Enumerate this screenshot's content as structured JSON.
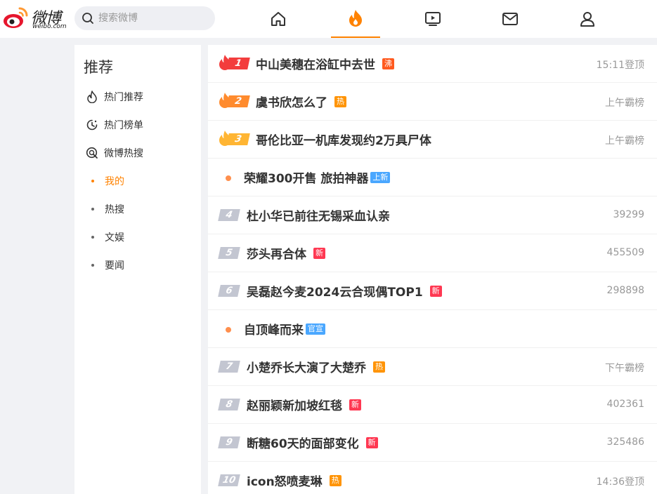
{
  "header": {
    "logo_text": "微博",
    "logo_domain": "weibo.com",
    "search_placeholder": "搜索微博",
    "nav": [
      {
        "name": "home-icon"
      },
      {
        "name": "hot-icon",
        "active": true
      },
      {
        "name": "video-icon"
      },
      {
        "name": "message-icon"
      },
      {
        "name": "profile-icon"
      }
    ]
  },
  "sidebar": {
    "title": "推荐",
    "items": [
      {
        "label": "热门推荐",
        "icon": "flame-outline-icon"
      },
      {
        "label": "热门榜单",
        "icon": "clock-icon"
      },
      {
        "label": "微博热搜",
        "icon": "search-circle-icon"
      },
      {
        "label": "我的",
        "active": true
      },
      {
        "label": "热搜"
      },
      {
        "label": "文娱"
      },
      {
        "label": "要闻"
      }
    ]
  },
  "colors": {
    "accent": "#ff8200",
    "badge_boil": "#ff5a1f",
    "badge_hot": "#ff9406",
    "badge_new": "#ff3852",
    "badge_up": "#4aa7ff",
    "badge_official": "#4aa7ff"
  },
  "hot_list": [
    {
      "rank": "1",
      "title": "中山美穗在浴缸中去世",
      "badge": "沸",
      "badge_type": "boil",
      "meta": "15:11登顶"
    },
    {
      "rank": "2",
      "title": "虞书欣怎么了",
      "badge": "热",
      "badge_type": "hot",
      "meta": "上午霸榜"
    },
    {
      "rank": "3",
      "title": "哥伦比亚一机库发现约2万具尸体",
      "badge": "",
      "badge_type": "",
      "meta": "上午霸榜"
    },
    {
      "rank": "",
      "title": "荣耀300开售 旅拍神器",
      "badge": "上新",
      "badge_type": "up",
      "meta": ""
    },
    {
      "rank": "4",
      "title": "杜小华已前往无锡采血认亲",
      "badge": "",
      "badge_type": "",
      "meta": "39299"
    },
    {
      "rank": "5",
      "title": "莎头再合体",
      "badge": "新",
      "badge_type": "new",
      "meta": "455509"
    },
    {
      "rank": "6",
      "title": "吴磊赵今麦2024云合现偶TOP1",
      "badge": "新",
      "badge_type": "new",
      "meta": "298898"
    },
    {
      "rank": "",
      "title": "自顶峰而来",
      "badge": "官宣",
      "badge_type": "official",
      "meta": ""
    },
    {
      "rank": "7",
      "title": "小楚乔长大演了大楚乔",
      "badge": "热",
      "badge_type": "hot",
      "meta": "下午霸榜"
    },
    {
      "rank": "8",
      "title": "赵丽颖新加坡红毯",
      "badge": "新",
      "badge_type": "new",
      "meta": "402361"
    },
    {
      "rank": "9",
      "title": "断糖60天的面部变化",
      "badge": "新",
      "badge_type": "new",
      "meta": "325486"
    },
    {
      "rank": "10",
      "title": "icon怒喷麦琳",
      "badge": "热",
      "badge_type": "hot",
      "meta": "14:36登顶"
    }
  ]
}
